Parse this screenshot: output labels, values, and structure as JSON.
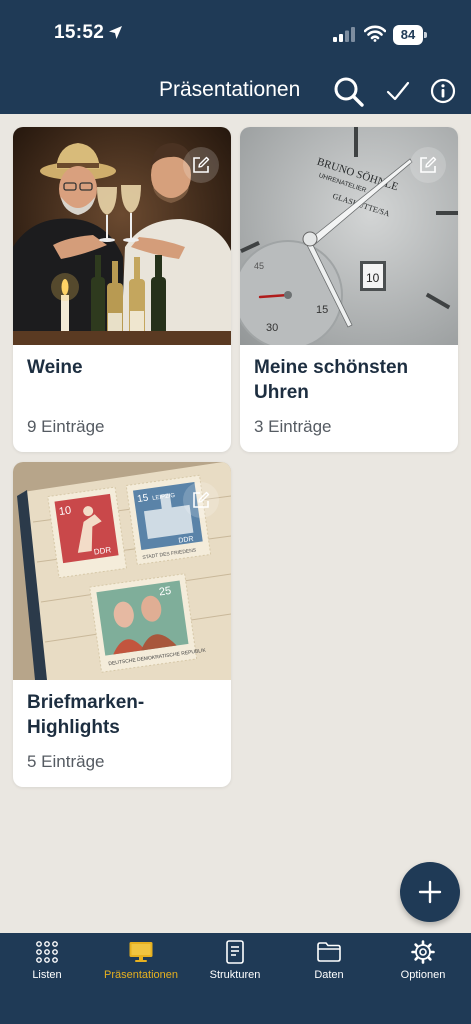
{
  "status_bar": {
    "time": "15:52",
    "battery": "84"
  },
  "header": {
    "title": "Präsentationen"
  },
  "cards": [
    {
      "title": "Weine",
      "count": "9 Einträge"
    },
    {
      "title": "Meine schönsten Uhren",
      "count": "3 Einträge"
    },
    {
      "title": "Briefmarken-Highlights",
      "count": "5 Einträge"
    }
  ],
  "watch_text": {
    "brand": "BRUNO SÖHNLE",
    "sub": "UHRENATELIER",
    "city": "GLASHÜTTE/SA",
    "date": "10",
    "small_15": "15",
    "small_30": "30",
    "small_45": "45"
  },
  "stamps": [
    {
      "value": "10",
      "country": "DDR"
    },
    {
      "value": "15",
      "place": "LEIPZIG",
      "country": "DDR",
      "caption": "STADT DES FRIEDENS"
    },
    {
      "value": "25",
      "caption": "DEUTSCHE DEMOKRATISCHE REPUBLIK"
    }
  ],
  "tabs": [
    {
      "label": "Listen"
    },
    {
      "label": "Präsentationen"
    },
    {
      "label": "Strukturen"
    },
    {
      "label": "Daten"
    },
    {
      "label": "Optionen"
    }
  ],
  "colors": {
    "header_bg": "#1f3a56",
    "page_bg": "#eae7e1",
    "active_tab": "#e6b020",
    "card_title": "#1d2e40"
  }
}
